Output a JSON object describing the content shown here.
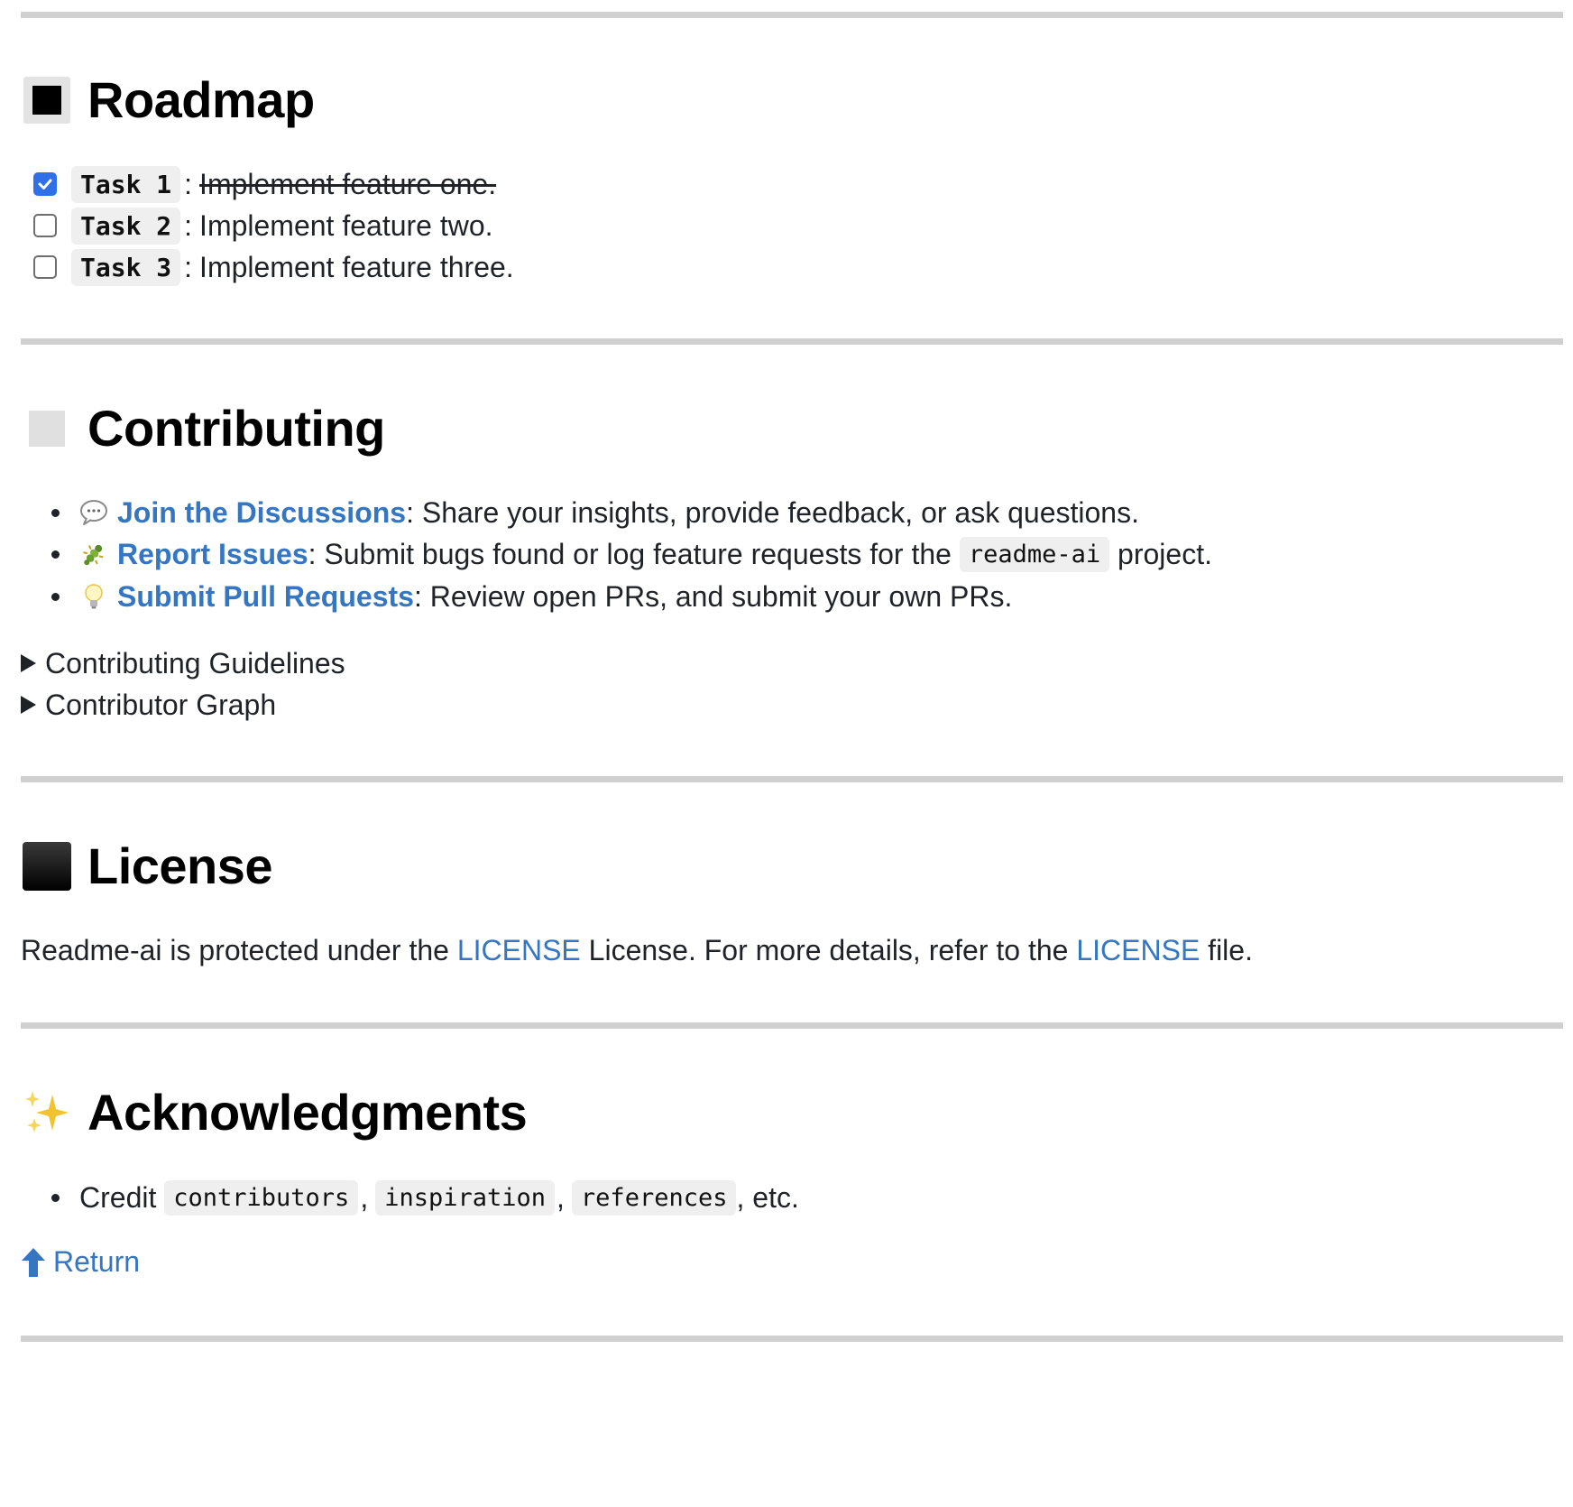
{
  "roadmap": {
    "title": "Roadmap",
    "emoji": "black-square-icon",
    "tasks": [
      {
        "label": "Task 1",
        "desc": "Implement feature one.",
        "checked": true
      },
      {
        "label": "Task 2",
        "desc": "Implement feature two.",
        "checked": false
      },
      {
        "label": "Task 3",
        "desc": "Implement feature three.",
        "checked": false
      }
    ]
  },
  "contributing": {
    "title": "Contributing",
    "emoji": "white-square-icon",
    "items": [
      {
        "icon": "speech-bubble-icon",
        "link": "Join the Discussions",
        "text": ": Share your insights, provide feedback, or ask questions."
      },
      {
        "icon": "bug-icon",
        "link": "Report Issues",
        "text_before": ": Submit bugs found or log feature requests for the ",
        "code": "readme-ai",
        "text_after": " project."
      },
      {
        "icon": "lightbulb-icon",
        "link": "Submit Pull Requests",
        "text": ": Review open PRs, and submit your own PRs."
      }
    ],
    "details": [
      "Contributing Guidelines",
      "Contributor Graph"
    ]
  },
  "license": {
    "title": "License",
    "emoji": "black-large-square-icon",
    "text_1": "Readme-ai is protected under the ",
    "link_1": "LICENSE",
    "text_2": " License. For more details, refer to the ",
    "link_2": "LICENSE",
    "text_3": " file."
  },
  "acknowledgments": {
    "title": "Acknowledgments",
    "emoji": "sparkles-icon",
    "credit_prefix": "Credit ",
    "codes": [
      "contributors",
      "inspiration",
      "references"
    ],
    "credit_suffix": ", etc.",
    "comma": ","
  },
  "return_link": {
    "icon": "up-arrow-icon",
    "label": "Return"
  },
  "colors": {
    "link": "#3476c2",
    "checkbox": "#2f6fe8",
    "rule": "#d0d0d0"
  }
}
